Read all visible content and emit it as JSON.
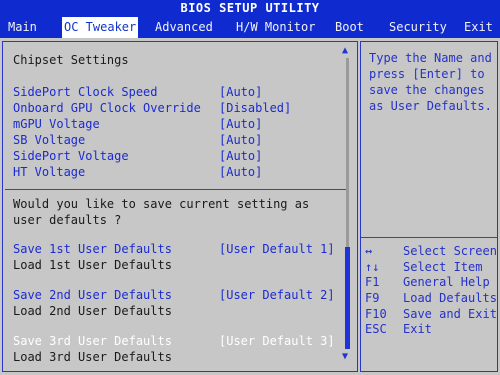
{
  "title": "BIOS SETUP UTILITY",
  "tabs": [
    {
      "label": "Main"
    },
    {
      "label": "OC Tweaker"
    },
    {
      "label": "Advanced"
    },
    {
      "label": "H/W Monitor"
    },
    {
      "label": "Boot"
    },
    {
      "label": "Security"
    },
    {
      "label": "Exit"
    }
  ],
  "active_tab": "OC Tweaker",
  "section_title": "Chipset Settings",
  "settings": [
    {
      "label": "SidePort Clock Speed",
      "value": "[Auto]"
    },
    {
      "label": "Onboard GPU Clock Override",
      "value": "[Disabled]"
    },
    {
      "label": "mGPU Voltage",
      "value": "[Auto]"
    },
    {
      "label": "SB Voltage",
      "value": "[Auto]"
    },
    {
      "label": "SidePort Voltage",
      "value": "[Auto]"
    },
    {
      "label": "HT Voltage",
      "value": "[Auto]"
    }
  ],
  "prompt": {
    "line1": "Would you like to save current setting as",
    "line2": "user defaults ?"
  },
  "user_defaults": [
    {
      "save_label": "Save 1st User Defaults",
      "save_value": "[User Default  1]",
      "load_label": "Load 1st User Defaults"
    },
    {
      "save_label": "Save 2nd User Defaults",
      "save_value": "[User Default  2]",
      "load_label": "Load 2nd User Defaults"
    },
    {
      "save_label": "Save 3rd User Defaults",
      "save_value": "[User Default  3]",
      "load_label": "Load 3rd User Defaults"
    }
  ],
  "help": {
    "lines": [
      "Type the Name and",
      "press [Enter] to",
      "save the changes",
      "as User Defaults."
    ]
  },
  "keys": [
    {
      "key": "↔",
      "desc": "Select Screen"
    },
    {
      "key": "↑↓",
      "desc": "Select Item"
    },
    {
      "key": "F1",
      "desc": "General Help"
    },
    {
      "key": "F9",
      "desc": "Load Defaults"
    },
    {
      "key": "F10",
      "desc": "Save and Exit"
    },
    {
      "key": "ESC",
      "desc": "Exit"
    }
  ],
  "colors": {
    "header_bg": "#0f2bd0",
    "panel_bg": "#c7c7c7",
    "accent_blue": "#1b2bd0"
  }
}
